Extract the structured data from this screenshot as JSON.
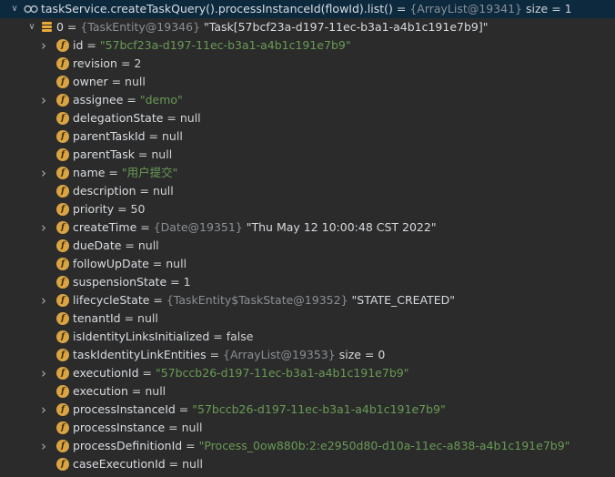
{
  "root": {
    "expression": "taskService.createTaskQuery().processInstanceId(flowId).list()",
    "ref": "{ArrayList@19341}",
    "size_text": "size = 1"
  },
  "element": {
    "index": "0",
    "ref": "{TaskEntity@19346}",
    "value": "\"Task[57bcf23a-d197-11ec-b3a1-a4b1c191e7b9]\""
  },
  "fields": [
    {
      "name": "id",
      "expandable": true,
      "value": "\"57bcf23a-d197-11ec-b3a1-a4b1c191e7b9\"",
      "kind": "string"
    },
    {
      "name": "revision",
      "expandable": false,
      "value": "2",
      "kind": "plain"
    },
    {
      "name": "owner",
      "expandable": false,
      "value": "null",
      "kind": "plain"
    },
    {
      "name": "assignee",
      "expandable": true,
      "value": "\"demo\"",
      "kind": "string"
    },
    {
      "name": "delegationState",
      "expandable": false,
      "value": "null",
      "kind": "plain"
    },
    {
      "name": "parentTaskId",
      "expandable": false,
      "value": "null",
      "kind": "plain"
    },
    {
      "name": "parentTask",
      "expandable": false,
      "value": "null",
      "kind": "plain"
    },
    {
      "name": "name",
      "expandable": true,
      "value": "\"用户提交\"",
      "kind": "string"
    },
    {
      "name": "description",
      "expandable": false,
      "value": "null",
      "kind": "plain"
    },
    {
      "name": "priority",
      "expandable": false,
      "value": "50",
      "kind": "plain"
    },
    {
      "name": "createTime",
      "expandable": true,
      "ref": "{Date@19351}",
      "value": "\"Thu May 12 10:00:48 CST 2022\"",
      "kind": "object"
    },
    {
      "name": "dueDate",
      "expandable": false,
      "value": "null",
      "kind": "plain"
    },
    {
      "name": "followUpDate",
      "expandable": false,
      "value": "null",
      "kind": "plain"
    },
    {
      "name": "suspensionState",
      "expandable": false,
      "value": "1",
      "kind": "plain"
    },
    {
      "name": "lifecycleState",
      "expandable": true,
      "ref": "{TaskEntity$TaskState@19352}",
      "value": "\"STATE_CREATED\"",
      "kind": "object"
    },
    {
      "name": "tenantId",
      "expandable": false,
      "value": "null",
      "kind": "plain"
    },
    {
      "name": "isIdentityLinksInitialized",
      "expandable": false,
      "value": "false",
      "kind": "plain"
    },
    {
      "name": "taskIdentityLinkEntities",
      "expandable": false,
      "ref": "{ArrayList@19353}",
      "value": "size = 0",
      "kind": "object"
    },
    {
      "name": "executionId",
      "expandable": true,
      "value": "\"57bccb26-d197-11ec-b3a1-a4b1c191e7b9\"",
      "kind": "string"
    },
    {
      "name": "execution",
      "expandable": false,
      "value": "null",
      "kind": "plain"
    },
    {
      "name": "processInstanceId",
      "expandable": true,
      "value": "\"57bccb26-d197-11ec-b3a1-a4b1c191e7b9\"",
      "kind": "string"
    },
    {
      "name": "processInstance",
      "expandable": false,
      "value": "null",
      "kind": "plain"
    },
    {
      "name": "processDefinitionId",
      "expandable": true,
      "value": "\"Process_0ow880b:2:e2950d80-d10a-11ec-a838-a4b1c191e7b9\"",
      "kind": "string"
    },
    {
      "name": "caseExecutionId",
      "expandable": false,
      "value": "null",
      "kind": "plain"
    }
  ],
  "colors": {
    "background": "#2b2b2b",
    "selection": "#0d293e",
    "string": "#6a9a55",
    "reference": "#8a8f96",
    "field_icon": "#d9a443",
    "array_icon": "#e8a83a"
  },
  "icons": {
    "root": "watch-glasses-icon",
    "element": "array-element-icon",
    "field": "field-f-icon",
    "expanded": "chevron-down-icon",
    "collapsed": "chevron-right-icon"
  }
}
